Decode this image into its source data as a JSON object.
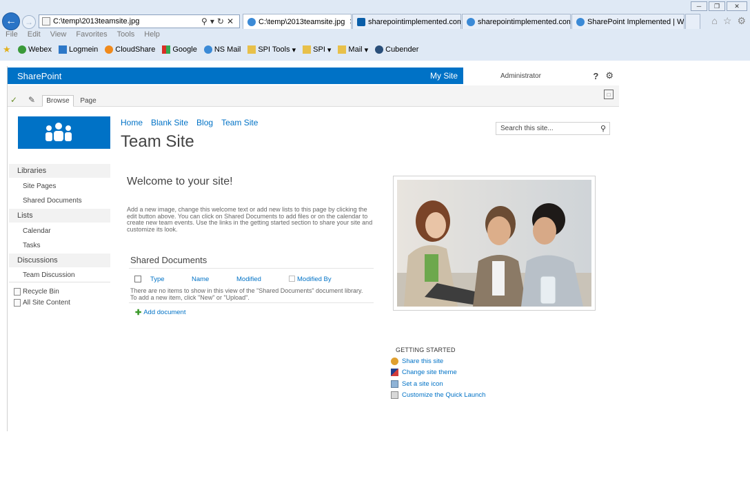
{
  "browser": {
    "address": "C:\\temp\\2013teamsite.jpg",
    "tabs": [
      {
        "label": "C:\\temp\\2013teamsite.jpg",
        "active": true
      },
      {
        "label": "sharepointimplemented.com",
        "active": false
      },
      {
        "label": "sharepointimplemented.com",
        "active": false
      },
      {
        "label": "SharePoint Implemented | Wel...",
        "active": false
      }
    ],
    "menu": [
      "File",
      "Edit",
      "View",
      "Favorites",
      "Tools",
      "Help"
    ],
    "favorites": [
      "Webex",
      "Logmein",
      "CloudShare",
      "Google",
      "NS Mail",
      "SPI Tools",
      "SPI",
      "Mail",
      "Cubender"
    ]
  },
  "suite": {
    "brand": "SharePoint",
    "my_site": "My Site",
    "user": "Administrator",
    "help": "?"
  },
  "ribbon": {
    "tabs": [
      "Browse",
      "Page"
    ]
  },
  "site": {
    "top_nav": [
      "Home",
      "Blank Site",
      "Blog",
      "Team Site"
    ],
    "title": "Team Site",
    "search_placeholder": "Search this site..."
  },
  "quick_launch": {
    "libraries": "Libraries",
    "site_pages": "Site Pages",
    "shared_documents": "Shared Documents",
    "lists": "Lists",
    "calendar": "Calendar",
    "tasks": "Tasks",
    "discussions": "Discussions",
    "team_discussion": "Team Discussion",
    "recycle_bin": "Recycle Bin",
    "all_site_content": "All Site Content"
  },
  "main": {
    "welcome": "Welcome to your site!",
    "intro": "Add a new image, change this welcome text or add new lists to this page by clicking the edit button above. You can click on Shared Documents to add files or on the calendar to create new team events. Use the links in the getting started section to share your site and customize its look.",
    "docs_title": "Shared Documents",
    "columns": [
      "Type",
      "Name",
      "Modified",
      "Modified By"
    ],
    "empty_message": "There are no items to show in this view of the \"Shared Documents\" document library. To add a new item, click \"New\" or \"Upload\".",
    "add_document": "Add document"
  },
  "getting_started": {
    "title": "GETTING STARTED",
    "items": [
      "Share this site",
      "Change site theme",
      "Set a site icon",
      "Customize the Quick Launch"
    ]
  },
  "colors": {
    "accent": "#0072c6",
    "suite_bar": "#0072c6",
    "link": "#0072c6"
  }
}
